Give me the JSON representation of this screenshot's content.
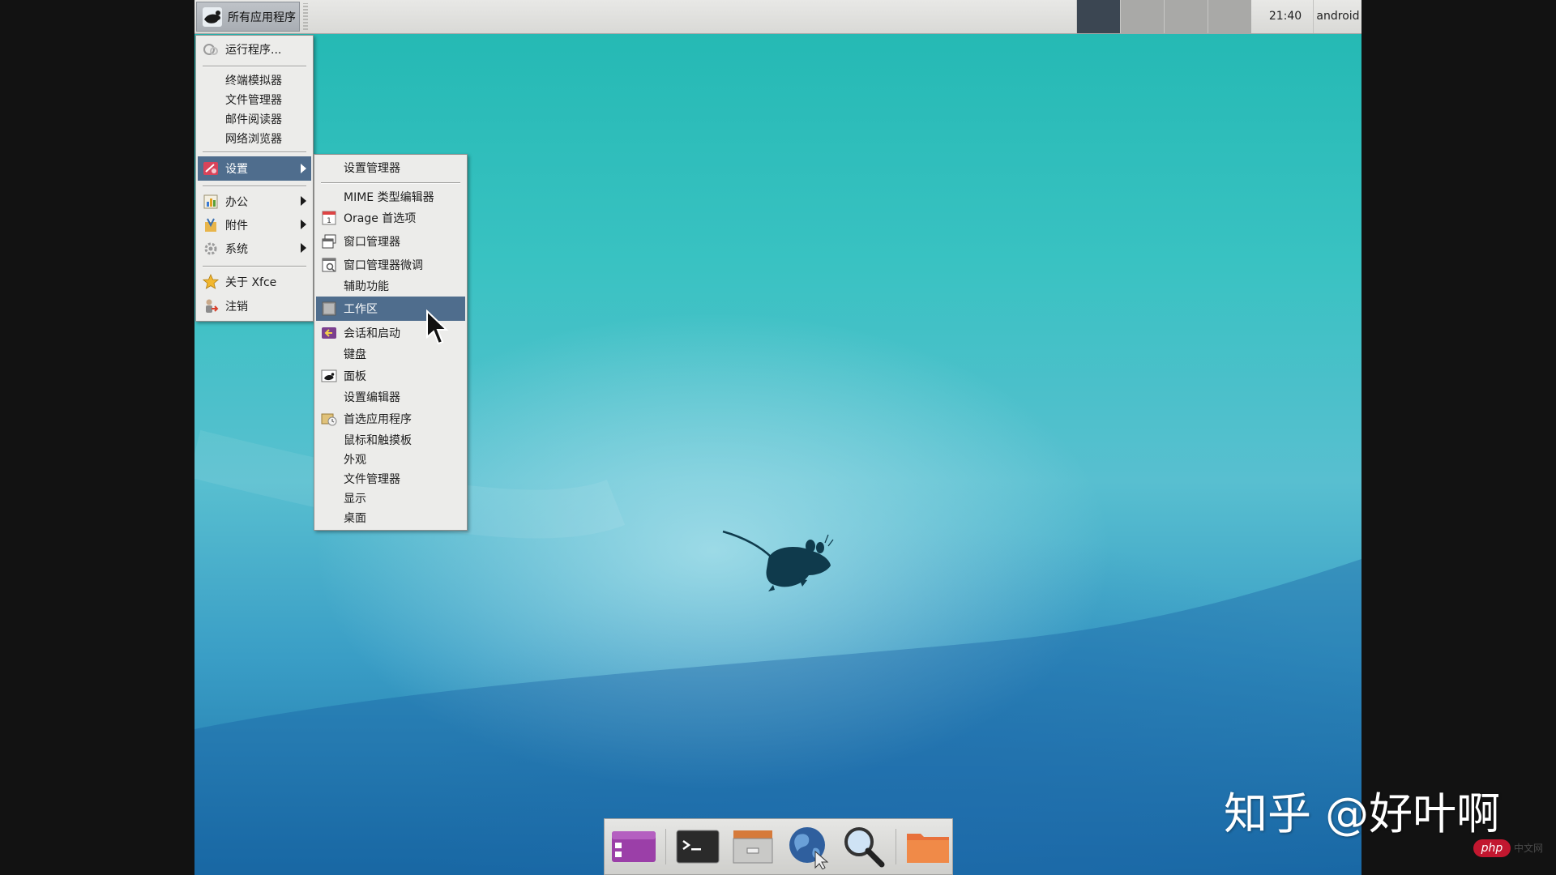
{
  "top_panel": {
    "apps_menu_label": "所有应用程序",
    "clock": "21:40",
    "user": "android",
    "workspace_count": 4,
    "active_workspace": 1
  },
  "main_menu": {
    "items": [
      {
        "label": "运行程序...",
        "icon": "run-icon"
      },
      {
        "label": "终端模拟器"
      },
      {
        "label": "文件管理器"
      },
      {
        "label": "邮件阅读器"
      },
      {
        "label": "网络浏览器"
      },
      {
        "label": "设置",
        "icon": "settings-icon",
        "submenu": true,
        "highlighted": true
      },
      {
        "label": "办公",
        "icon": "office-icon",
        "submenu": true
      },
      {
        "label": "附件",
        "icon": "accessories-icon",
        "submenu": true
      },
      {
        "label": "系统",
        "icon": "system-icon",
        "submenu": true
      },
      {
        "label": "关于 Xfce",
        "icon": "star-icon"
      },
      {
        "label": "注销",
        "icon": "logout-icon"
      }
    ]
  },
  "settings_menu": {
    "items": [
      {
        "label": "设置管理器"
      },
      {
        "label": "MIME 类型编辑器"
      },
      {
        "label": "Orage 首选项",
        "icon": "calendar-icon"
      },
      {
        "label": "窗口管理器",
        "icon": "window-icon"
      },
      {
        "label": "窗口管理器微调",
        "icon": "window-tweaks-icon"
      },
      {
        "label": "辅助功能"
      },
      {
        "label": "工作区",
        "icon": "workspace-icon",
        "highlighted": true
      },
      {
        "label": "会话和启动",
        "icon": "session-icon"
      },
      {
        "label": "键盘"
      },
      {
        "label": "面板",
        "icon": "panel-icon"
      },
      {
        "label": "设置编辑器"
      },
      {
        "label": "首选应用程序",
        "icon": "preferred-apps-icon"
      },
      {
        "label": "鼠标和触摸板"
      },
      {
        "label": "外观"
      },
      {
        "label": "文件管理器"
      },
      {
        "label": "显示"
      },
      {
        "label": "桌面"
      }
    ]
  },
  "dock": {
    "items": [
      "show-desktop-icon",
      "terminal-icon",
      "file-cabinet-icon",
      "web-browser-icon",
      "search-icon",
      "folder-icon"
    ]
  },
  "watermark": {
    "text": "知乎 @好叶啊",
    "badge": "php",
    "badge_suffix": "中文网"
  },
  "colors": {
    "menu_highlight": "#4f6d8d",
    "panel_bg": "#dededb",
    "active_workspace": "#3b4652"
  }
}
